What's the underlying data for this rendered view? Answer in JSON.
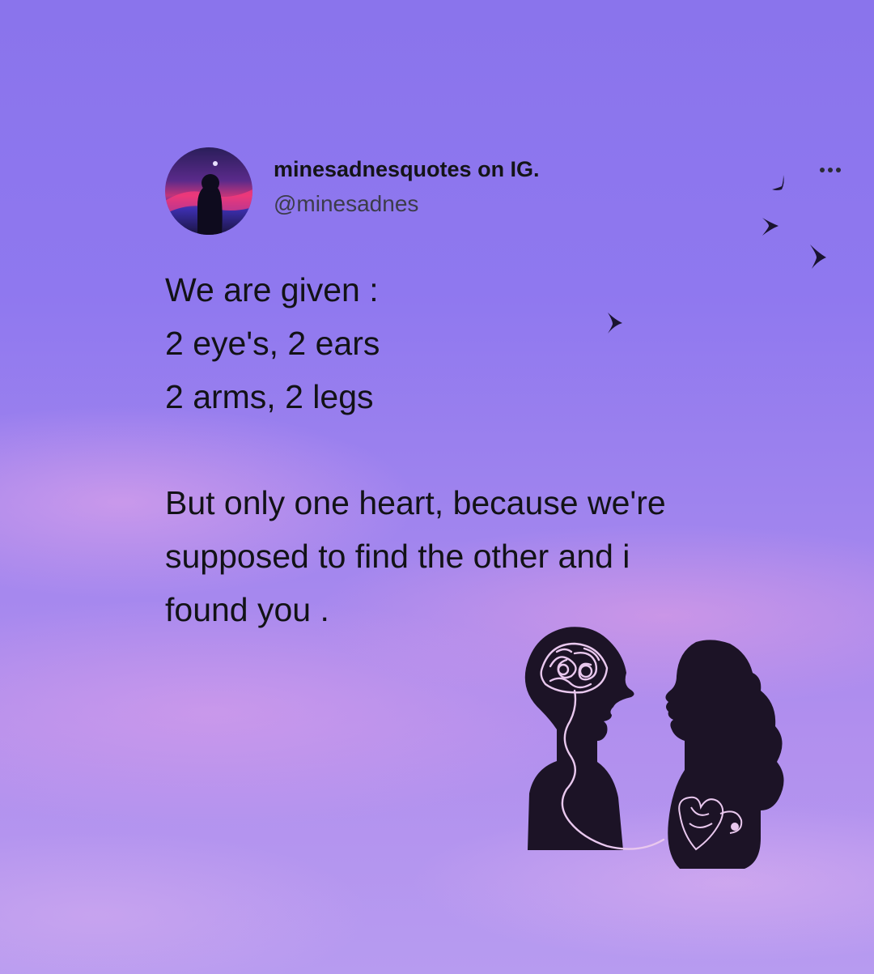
{
  "post": {
    "display_name": "minesadnesquotes on IG.",
    "handle": "@minesadnes",
    "more_icon": "more-dots-icon",
    "lines": [
      "We are given :",
      "2 eye's, 2 ears",
      "2 arms, 2 legs",
      "But only one heart, because we're",
      "supposed to find the other and i",
      "found you ."
    ]
  },
  "decorations": {
    "birds": [
      "bird-icon",
      "bird-icon",
      "bird-icon",
      "bird-icon"
    ],
    "illustration": "couple-silhouette-brain-heart"
  },
  "colors": {
    "sky_top": "#8a74ec",
    "sky_bottom": "#b79bf0",
    "cloud_pink": "#e8a6e8",
    "text": "#121216",
    "handle": "#3c3c4a",
    "silhouette": "#1c1326"
  }
}
